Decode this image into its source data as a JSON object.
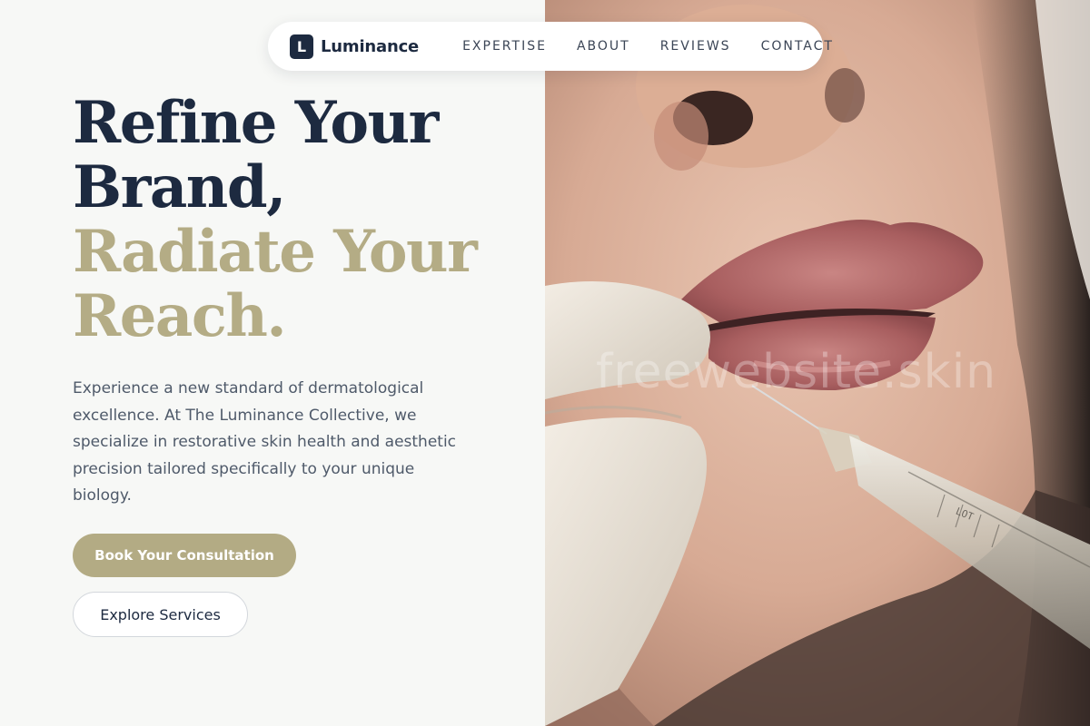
{
  "brand": {
    "logo_letter": "L",
    "name": "Luminance"
  },
  "nav": {
    "items": [
      {
        "label": "EXPERTISE"
      },
      {
        "label": "ABOUT"
      },
      {
        "label": "REVIEWS"
      },
      {
        "label": "CONTACT"
      }
    ]
  },
  "hero": {
    "headline": {
      "line1": "Refine Your",
      "line2": "Brand,",
      "line3": "Radiate Your",
      "line4": "Reach."
    },
    "description": "Experience a new standard of dermatological excellence. At The Luminance Collective, we specialize in restorative skin health and aesthetic precision tailored specifically to your unique biology.",
    "primary_cta": "Book Your Consultation",
    "secondary_cta": "Explore Services",
    "image_alt": "lip-filler-injection-photo",
    "syringe_text": "LOT"
  },
  "watermark": "freewebsite.skin",
  "colors": {
    "navy": "#1d2a40",
    "gold": "#b4ac85",
    "background": "#f7f8f6",
    "body_text": "#4f5a6a"
  }
}
